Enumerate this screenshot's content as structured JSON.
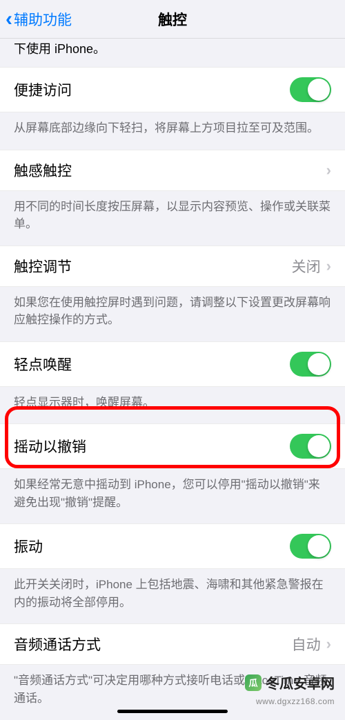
{
  "nav": {
    "back_label": "辅助功能",
    "title": "触控"
  },
  "partial_top_desc": "下使用 iPhone。",
  "sections": {
    "reachability": {
      "label": "便捷访问",
      "footer": "从屏幕底部边缘向下轻扫，将屏幕上方项目拉至可及范围。",
      "enabled": true
    },
    "haptic_touch": {
      "label": "触感触控",
      "footer": "用不同的时间长度按压屏幕，以显示内容预览、操作或关联菜单。"
    },
    "touch_accommodations": {
      "label": "触控调节",
      "value": "关闭",
      "footer": "如果您在使用触控屏时遇到问题，请调整以下设置更改屏幕响应触控操作的方式。"
    },
    "tap_to_wake": {
      "label": "轻点唤醒",
      "footer": "轻点显示器时，唤醒屏幕。",
      "enabled": true
    },
    "shake_to_undo": {
      "label": "摇动以撤销",
      "footer": "如果经常无意中摇动到 iPhone，您可以停用\"摇动以撤销\"来避免出现\"撤销\"提醒。",
      "enabled": true
    },
    "vibration": {
      "label": "振动",
      "footer": "此开关关闭时，iPhone 上包括地震、海啸和其他紧急警报在内的振动将全部停用。",
      "enabled": true
    },
    "call_audio": {
      "label": "音频通话方式",
      "value": "自动",
      "footer": "\"音频通话方式\"可决定用哪种方式接听电话或 FaceTime 音频通话。"
    }
  },
  "watermark": {
    "brand": "冬瓜安卓网",
    "url": "www.dgxzz168.com"
  }
}
